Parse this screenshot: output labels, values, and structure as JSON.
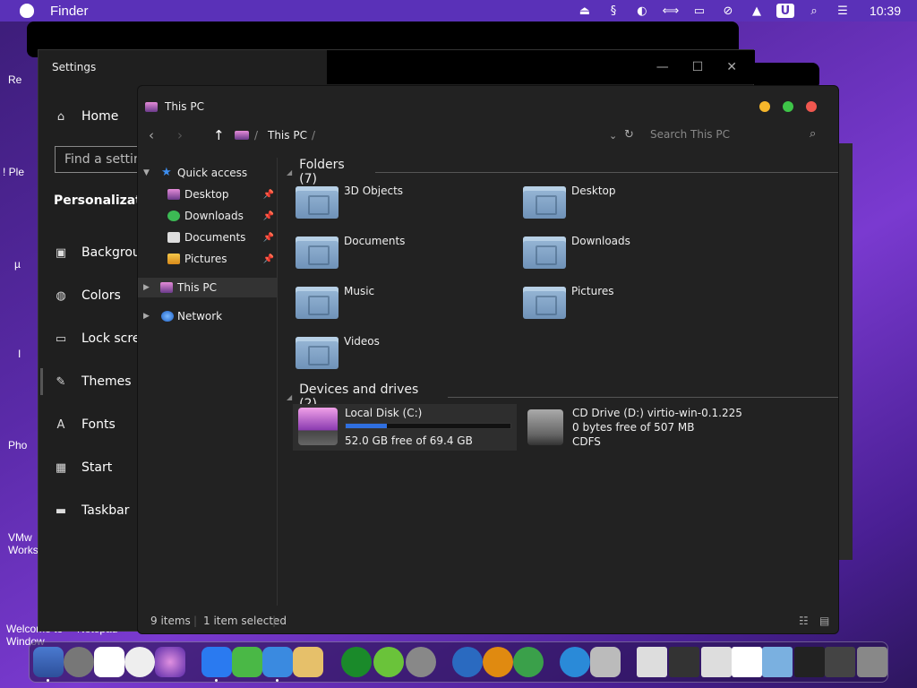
{
  "menubar": {
    "app": "Finder",
    "time": "10:39",
    "icons": [
      "eject-icon",
      "ucontrol-icon",
      "half-moon-icon",
      "arrows-icon",
      "display-icon",
      "mute-icon",
      "upload-icon",
      "u-icon",
      "search-icon",
      "toggle-icon"
    ]
  },
  "desktop_labels": [
    "Re",
    "! Ple",
    "µ",
    "I",
    "Pho",
    "VMw Works",
    "Welcome to",
    "Notepad++",
    "Window"
  ],
  "settings": {
    "title": "Settings",
    "search_placeholder": "Find a setting",
    "home": "Home",
    "section": "Personalization",
    "nav": [
      "Background",
      "Colors",
      "Lock screen",
      "Themes",
      "Fonts",
      "Start",
      "Taskbar"
    ]
  },
  "explorer": {
    "title": "This PC",
    "breadcrumb": "This PC",
    "search_placeholder": "Search This PC",
    "quick_access": "Quick access",
    "nav_items": [
      "Desktop",
      "Downloads",
      "Documents",
      "Pictures"
    ],
    "this_pc": "This PC",
    "network": "Network",
    "folders_header": "Folders (7)",
    "folders": [
      "3D Objects",
      "Desktop",
      "Documents",
      "Downloads",
      "Music",
      "Pictures",
      "Videos"
    ],
    "devices_header": "Devices and drives (2)",
    "drives": [
      {
        "name": "Local Disk (C:)",
        "free": "52.0 GB free of 69.4 GB",
        "used_fraction": 0.25
      },
      {
        "name": "CD Drive (D:) virtio-win-0.1.225",
        "free": "0 bytes free of 507 MB",
        "fs": "CDFS"
      }
    ],
    "status_items": "9 items",
    "status_selected": "1 item selected"
  },
  "colors": {
    "accent": "#2f6fe0",
    "close": "#f0574f",
    "minimize": "#f5b62b",
    "maximize": "#3ec548"
  }
}
